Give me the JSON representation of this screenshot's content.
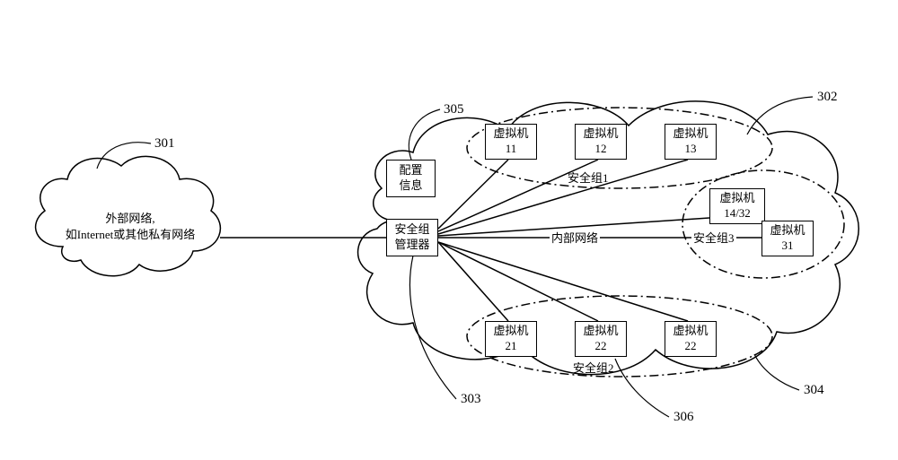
{
  "refs": {
    "r301": "301",
    "r302": "302",
    "r303": "303",
    "r304": "304",
    "r305": "305",
    "r306": "306"
  },
  "cloud1": {
    "l1": "外部网络,",
    "l2": "如Internet或其他私有网络"
  },
  "config": "配置\n信息",
  "manager": "安全组\n管理器",
  "groups": {
    "g1": "安全组1",
    "g2": "安全组2",
    "g3": "安全组3"
  },
  "inner": "内部网络",
  "vm": {
    "v11_t": "虚拟机",
    "v11_n": "11",
    "v12_t": "虚拟机",
    "v12_n": "12",
    "v13_t": "虚拟机",
    "v13_n": "13",
    "v1432_t": "虚拟机",
    "v1432_n": "14/32",
    "v31_t": "虚拟机",
    "v31_n": "31",
    "v21_t": "虚拟机",
    "v21_n": "21",
    "v22a_t": "虚拟机",
    "v22a_n": "22",
    "v22b_t": "虚拟机",
    "v22b_n": "22"
  }
}
